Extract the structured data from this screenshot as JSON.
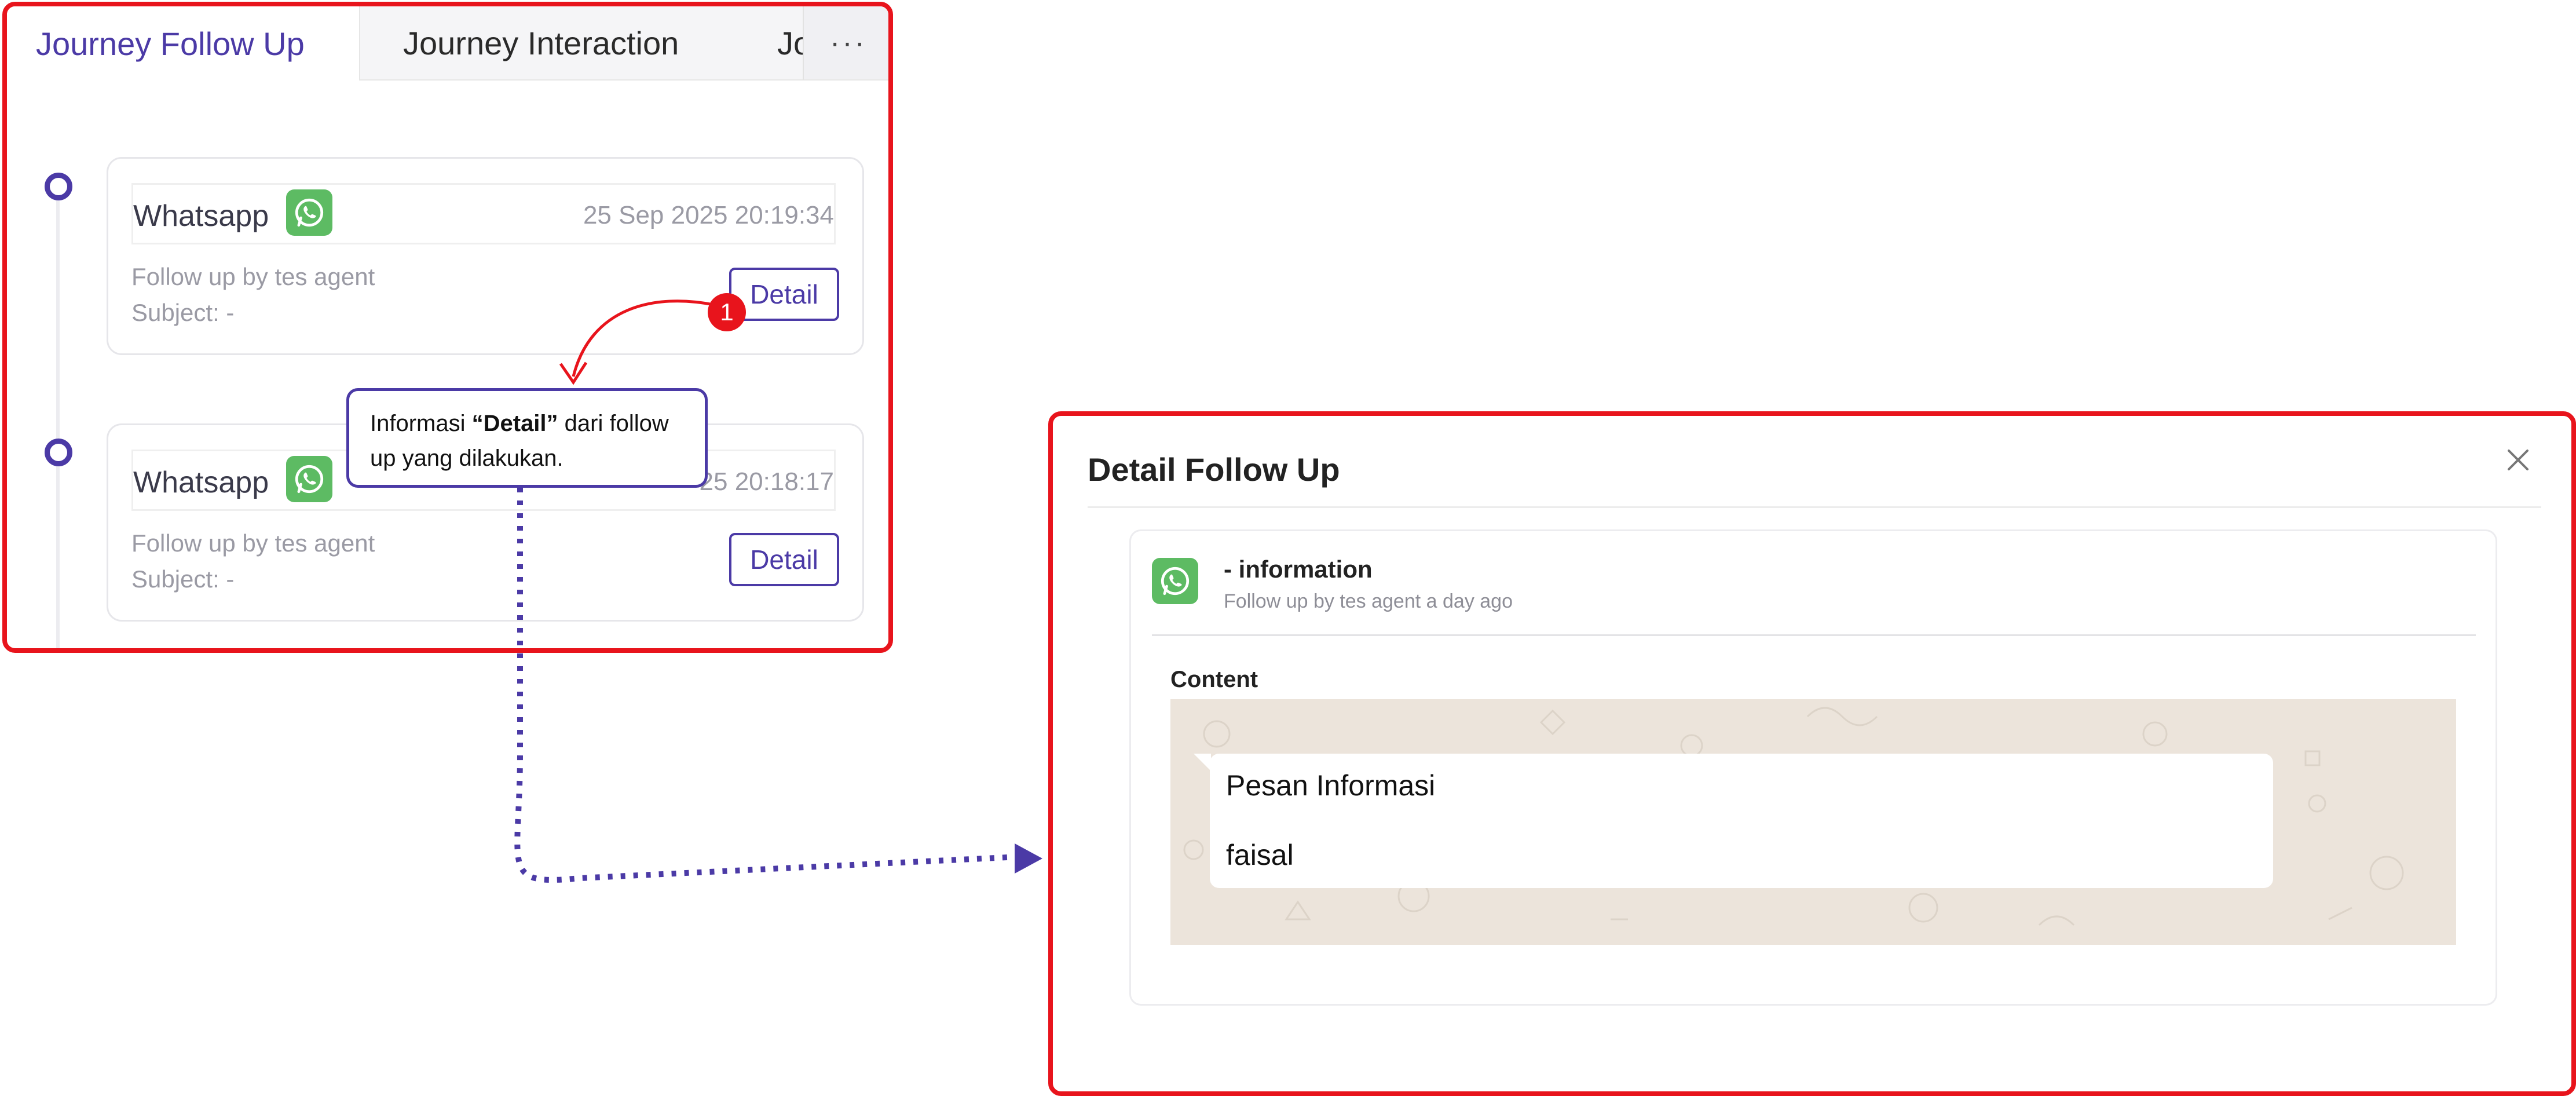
{
  "tabs": {
    "active": "Journey Follow Up",
    "second": "Journey Interaction",
    "third_partial": "Jo",
    "more": "···"
  },
  "timeline": [
    {
      "channel": "Whatsapp",
      "icon": "whatsapp-icon",
      "date": "25 Sep 2025 20:19:34",
      "followup": "Follow up by tes agent",
      "subject": "Subject: -",
      "button": "Detail"
    },
    {
      "channel": "Whatsapp",
      "icon": "whatsapp-icon",
      "date": "25 20:18:17",
      "followup": "Follow up by tes agent",
      "subject": "Subject: -",
      "button": "Detail"
    }
  ],
  "annotation": {
    "badge": "1",
    "text_before": "Informasi ",
    "text_bold": "“Detail”",
    "text_after": " dari follow up yang dilakukan."
  },
  "modal": {
    "title": "Detail Follow Up",
    "message_title": "- information",
    "message_sub": "Follow up by tes agent a day ago",
    "content_label": "Content",
    "bubble_lines": [
      "Pesan Informasi",
      "faisal"
    ]
  },
  "colors": {
    "accent": "#4b3aa6",
    "highlight_border": "#e8141c",
    "whatsapp": "#5dbb63",
    "chat_background": "#ece4db"
  }
}
